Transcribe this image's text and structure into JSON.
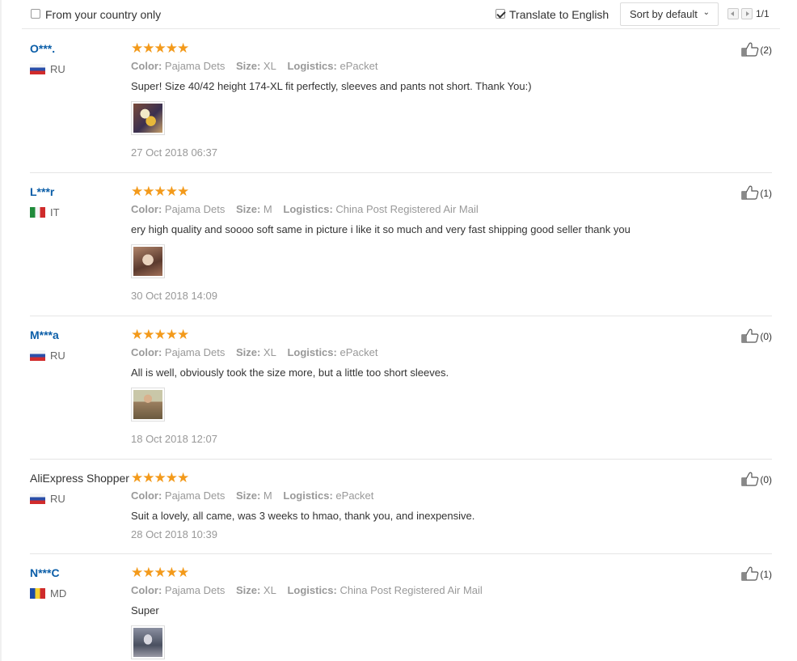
{
  "toolbar": {
    "country_only_label": "From your country only",
    "country_only_checked": false,
    "translate_label": "Translate to English",
    "translate_checked": true,
    "sort_label": "Sort by default",
    "page_count": "1/1"
  },
  "labels": {
    "color": "Color:",
    "size": "Size:",
    "logistics": "Logistics:"
  },
  "stars": "★★★★★",
  "reviews": [
    {
      "user": "O***.",
      "country": "RU",
      "rating": 5,
      "color": "Pajama Dets",
      "size": "XL",
      "logistics": "ePacket",
      "text": "Super! Size 40/42 height 174-XL fit perfectly, sleeves and pants not short. Thank You:)",
      "date": "27 Oct 2018 06:37",
      "likes": "(2)"
    },
    {
      "user": "L***r",
      "country": "IT",
      "rating": 5,
      "color": "Pajama Dets",
      "size": "M",
      "logistics": "China Post Registered Air Mail",
      "text": "ery high quality and soooo soft same in picture i like it so much and very fast shipping good seller thank you",
      "date": "30 Oct 2018 14:09",
      "likes": "(1)"
    },
    {
      "user": "M***a",
      "country": "RU",
      "rating": 5,
      "color": "Pajama Dets",
      "size": "XL",
      "logistics": "ePacket",
      "text": "All is well, obviously took the size more, but a little too short sleeves.",
      "date": "18 Oct 2018 12:07",
      "likes": "(0)"
    },
    {
      "user": "AliExpress Shopper",
      "country": "RU",
      "rating": 5,
      "color": "Pajama Dets",
      "size": "M",
      "logistics": "ePacket",
      "text": "Suit a lovely, all came, was 3 weeks to hmao, thank you, and inexpensive.",
      "date": "28 Oct 2018 10:39",
      "likes": "(0)"
    },
    {
      "user": "N***C",
      "country": "MD",
      "rating": 5,
      "color": "Pajama Dets",
      "size": "XL",
      "logistics": "China Post Registered Air Mail",
      "text": "Super",
      "likes": "(1)"
    }
  ]
}
